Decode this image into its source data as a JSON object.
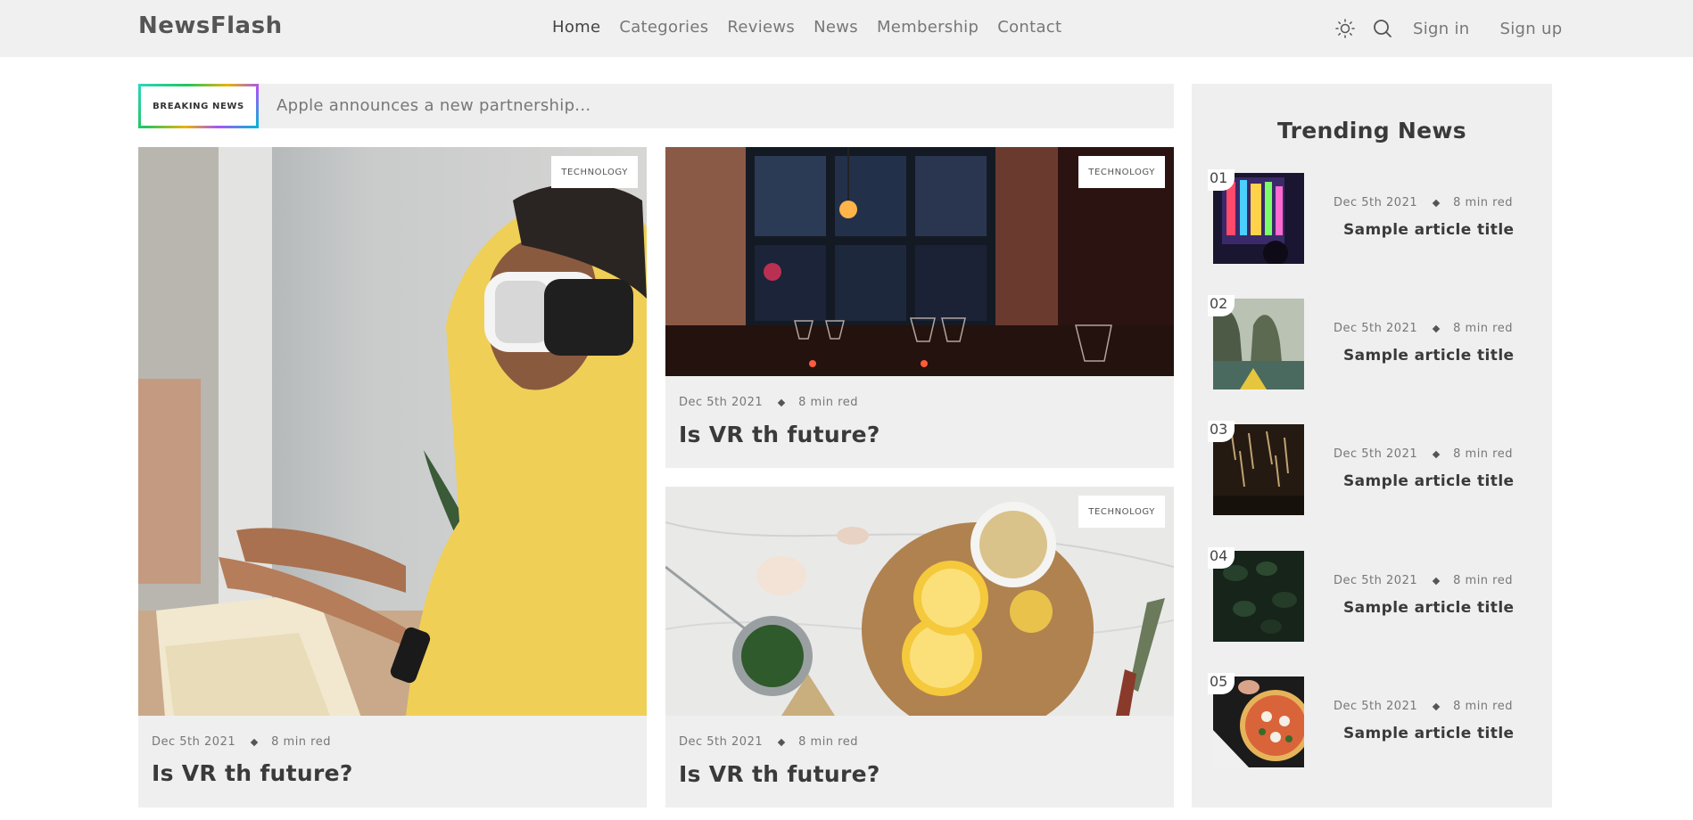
{
  "header": {
    "logo": "NewsFlash",
    "nav": [
      "Home",
      "Categories",
      "Reviews",
      "News",
      "Membership",
      "Contact"
    ],
    "active_nav": "Home",
    "theme_icon": "sun-icon",
    "search_icon": "search-icon",
    "sign_in": "Sign in",
    "sign_up": "Sign up"
  },
  "breaking": {
    "label": "BREAKING NEWS",
    "text": "Apple announces a new partnership..."
  },
  "articles": [
    {
      "tag": "TECHNOLOGY",
      "date": "Dec 5th 2021",
      "read": "8 min red",
      "title": "Is VR th future?",
      "image": "vr-headset-photo"
    },
    {
      "tag": "TECHNOLOGY",
      "date": "Dec 5th 2021",
      "read": "8 min red",
      "title": "Is VR th future?",
      "image": "restaurant-photo"
    },
    {
      "tag": "TECHNOLOGY",
      "date": "Dec 5th 2021",
      "read": "8 min red",
      "title": "Is VR th future?",
      "image": "lemons-food-photo"
    }
  ],
  "trending": {
    "title": "Trending News",
    "items": [
      {
        "num": "01",
        "date": "Dec 5th 2021",
        "read": "8 min red",
        "title": "Sample article title",
        "image": "neon-city-photo"
      },
      {
        "num": "02",
        "date": "Dec 5th 2021",
        "read": "8 min red",
        "title": "Sample article title",
        "image": "kayak-cliffs-photo"
      },
      {
        "num": "03",
        "date": "Dec 5th 2021",
        "read": "8 min red",
        "title": "Sample article title",
        "image": "bokeh-lights-photo"
      },
      {
        "num": "04",
        "date": "Dec 5th 2021",
        "read": "8 min red",
        "title": "Sample article title",
        "image": "leaves-photo"
      },
      {
        "num": "05",
        "date": "Dec 5th 2021",
        "read": "8 min red",
        "title": "Sample article title",
        "image": "pizza-photo"
      }
    ]
  },
  "colors": {
    "background": "#ffffff",
    "header_bg": "#f0f0f0",
    "card_bg": "#efefef",
    "text_dark": "#3a3a3a",
    "text_muted": "#777777"
  }
}
